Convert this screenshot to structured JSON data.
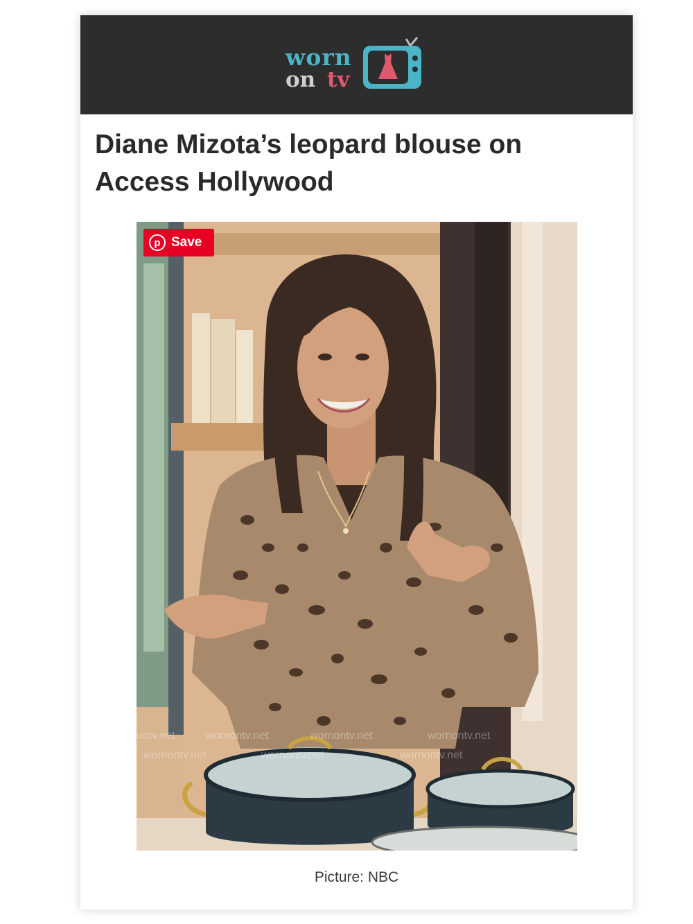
{
  "logo": {
    "line1": "worn",
    "line2_a": "on",
    "line2_b": "tv",
    "icon": "dress-tv-icon",
    "colors": {
      "teal": "#4bb4c6",
      "pink": "#e0586c",
      "grey": "#cfcfcf"
    }
  },
  "header": {
    "background": "#2d2d2d"
  },
  "article": {
    "title": "Diane Mizota’s leopard blouse on Access Hollywood",
    "caption": "Picture: NBC"
  },
  "image": {
    "watermark": "wornontv.net",
    "save_button": {
      "label": "Save",
      "icon": "pinterest-icon",
      "color": "#e60023"
    }
  }
}
